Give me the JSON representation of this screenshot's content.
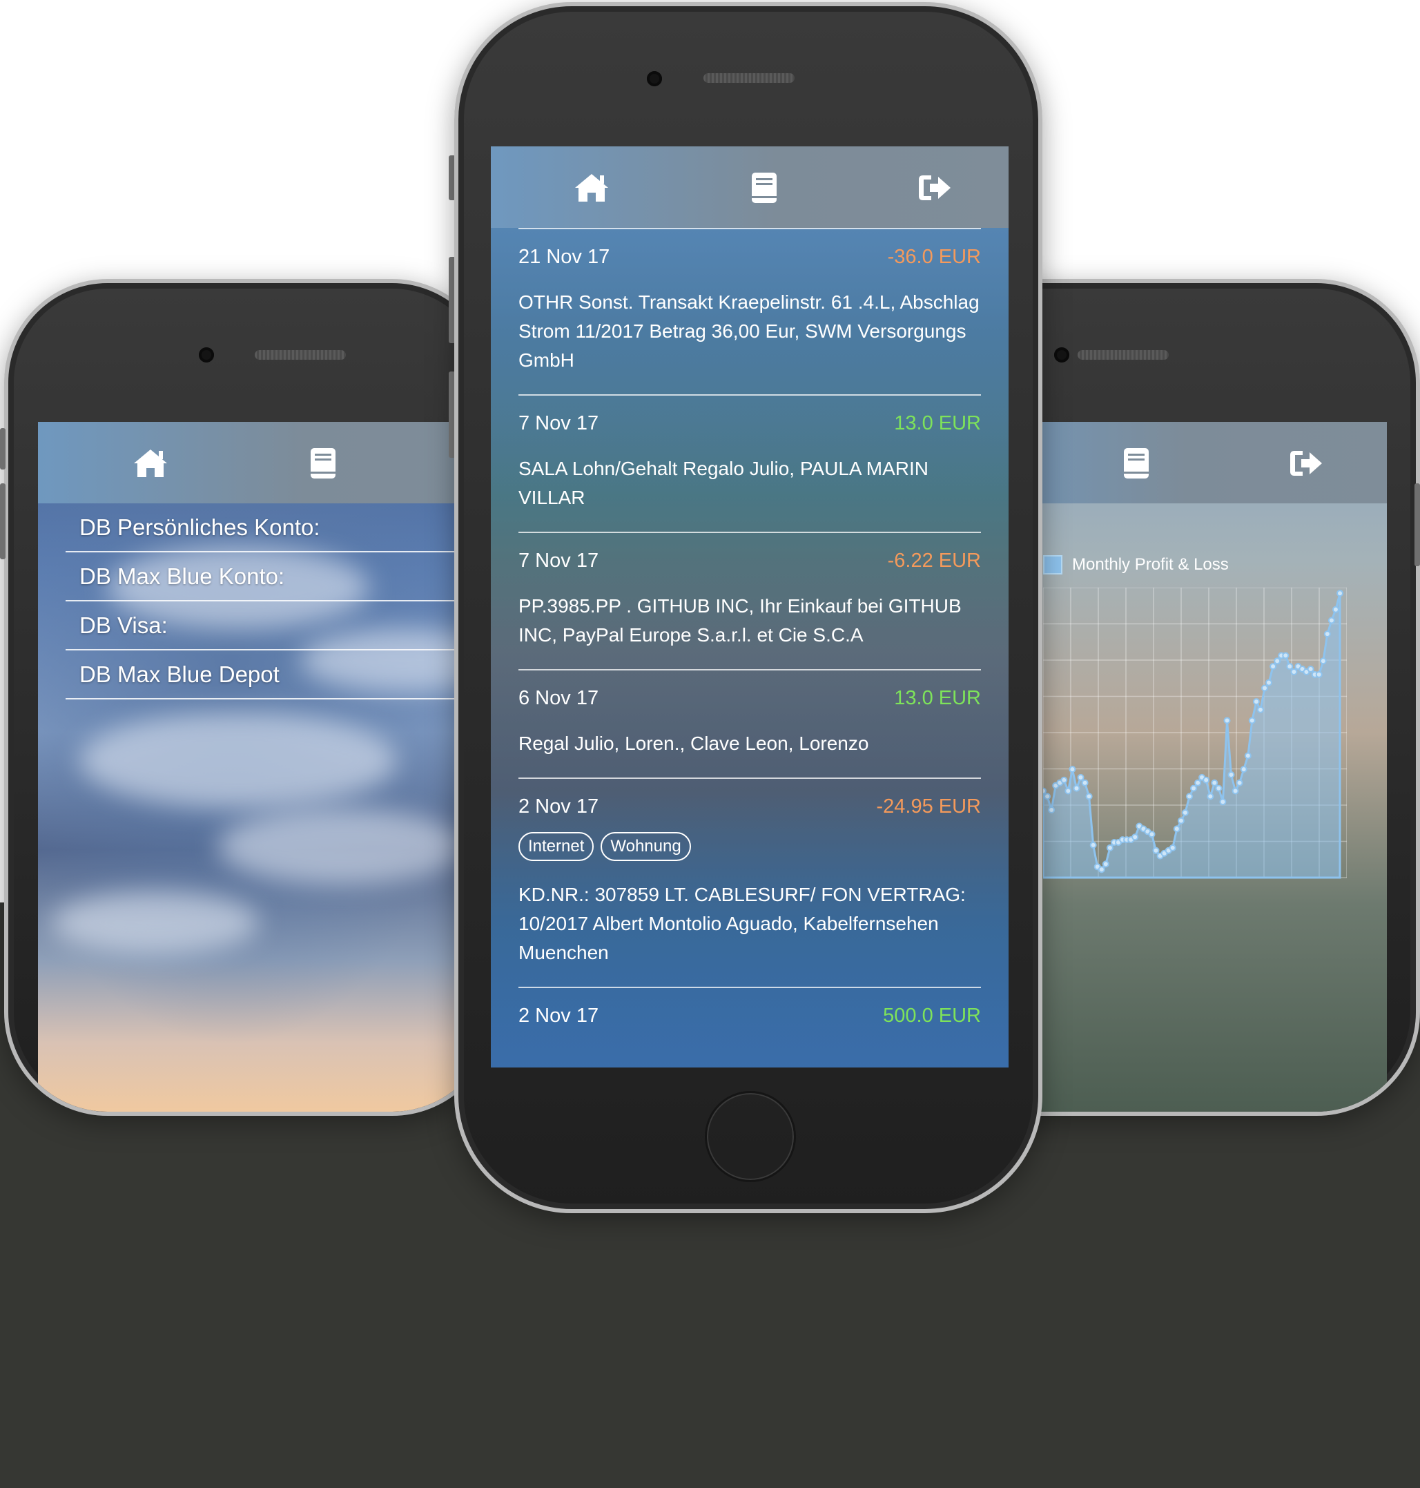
{
  "left_phone": {
    "nav": {
      "home_icon": "home-icon",
      "book_icon": "book-icon"
    },
    "accounts": [
      "DB Persönliches Konto:",
      "DB Max Blue Konto:",
      "DB Visa:",
      "DB Max Blue Depot"
    ]
  },
  "center_phone": {
    "nav": {
      "home_icon": "home-icon",
      "book_icon": "book-icon",
      "logout_icon": "sign-out-icon"
    },
    "transactions": [
      {
        "date": "21 Nov 17",
        "amount": "-36.0 EUR",
        "text": "OTHR Sonst. Transakt Kraepelinstr. 61 .4.L, Abschlag Strom 11/2017 Betrag 36,00 Eur, SWM Versorgungs GmbH"
      },
      {
        "date": "7 Nov 17",
        "amount": "13.0 EUR",
        "text": "SALA Lohn/Gehalt Regalo Julio, PAULA MARIN VILLAR"
      },
      {
        "date": "7 Nov 17",
        "amount": "-6.22 EUR",
        "text": "PP.3985.PP . GITHUB INC, Ihr Einkauf bei GITHUB INC, PayPal Europe S.a.r.l. et Cie S.C.A"
      },
      {
        "date": "6 Nov 17",
        "amount": "13.0 EUR",
        "text": "Regal Julio, Loren., Clave Leon, Lorenzo"
      },
      {
        "date": "2 Nov 17",
        "amount": "-24.95 EUR",
        "tags": [
          "Internet",
          "Wohnung"
        ],
        "text": "KD.NR.: 307859 LT. CABLESURF/ FON VERTRAG: 10/2017 Albert Montolio Aguado, Kabelfernsehen Muenchen"
      },
      {
        "date": "2 Nov 17",
        "amount": "500.0 EUR"
      }
    ],
    "colors": {
      "negative": "#f59a5b",
      "positive": "#7ee35a"
    }
  },
  "right_phone": {
    "nav": {
      "book_icon": "book-icon",
      "logout_icon": "sign-out-icon"
    },
    "chart_data": {
      "type": "area",
      "legend": [
        "Monthly Profit & Loss"
      ],
      "grid": true,
      "series": [
        {
          "name": "Monthly Profit & Loss",
          "color": "#8ec3ee",
          "values": [
            32,
            30,
            25,
            34,
            35,
            36,
            32,
            40,
            33,
            37,
            35,
            30,
            12,
            4,
            3,
            5,
            11,
            13,
            13,
            14,
            14,
            14,
            15,
            19,
            18,
            17,
            16,
            10,
            8,
            9,
            10,
            11,
            18,
            21,
            24,
            30,
            33,
            35,
            37,
            36,
            30,
            35,
            33,
            28,
            58,
            38,
            32,
            35,
            40,
            45,
            58,
            65,
            62,
            70,
            72,
            78,
            80,
            82,
            82,
            78,
            76,
            78,
            77,
            76,
            77,
            75,
            75,
            80,
            90,
            95,
            99,
            105
          ]
        }
      ]
    }
  }
}
